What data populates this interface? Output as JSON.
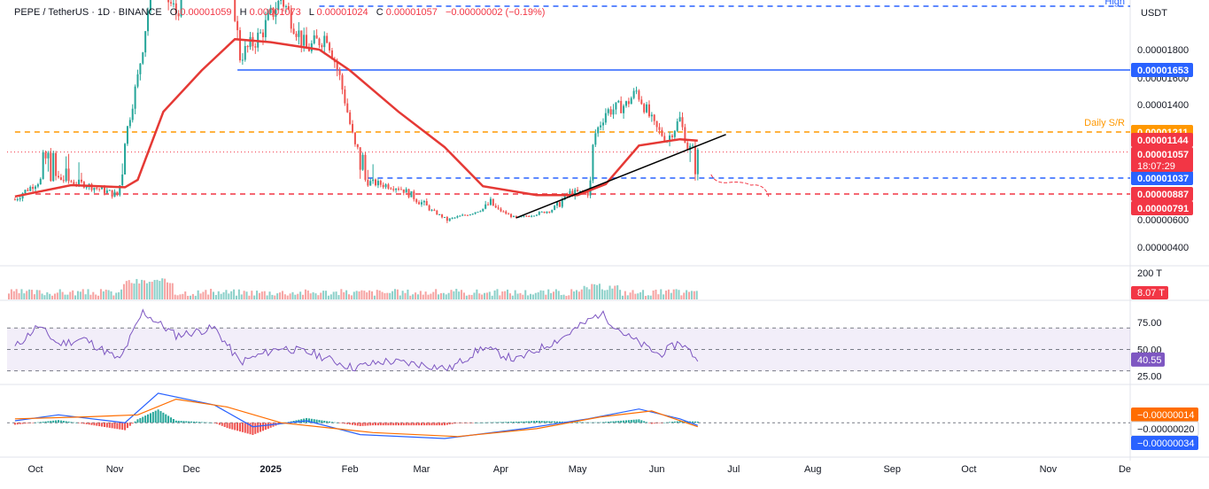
{
  "header": {
    "symbol": "PEPE / TetherUS · 1D · BINANCE",
    "open_label": "O",
    "open": "0.00001059",
    "high_label": "H",
    "high": "0.00001073",
    "low_label": "L",
    "low": "0.00001024",
    "close_label": "C",
    "close": "0.00001057",
    "change": "−0.00000002 (−0.19%)",
    "currency": "USDT"
  },
  "colors": {
    "up": "#26a69a",
    "down": "#ef5350",
    "ma": "#e53935",
    "blue_level": "#2962ff",
    "orange_level": "#ff9800",
    "red_level": "#f23645",
    "trendline": "#000000",
    "rsi_line": "#7e57c2",
    "macd_line": "#2962ff",
    "signal_line": "#ff6d00"
  },
  "chart_data": [
    {
      "type": "candlestick",
      "title": "PEPE / TetherUS · 1D · BINANCE",
      "x_ticks": [
        "Oct",
        "Nov",
        "Dec",
        "2025",
        "Feb",
        "Mar",
        "Apr",
        "May",
        "Jun",
        "Jul",
        "Aug",
        "Sep",
        "Oct",
        "Nov",
        "De"
      ],
      "y_ticks": [
        "0.00001800",
        "0.00001600",
        "0.00001400",
        "0.00000600",
        "0.00000400"
      ],
      "ylim": [
        2.7e-06,
        2.09e-05
      ],
      "price_path": [
        [
          "2024-09-23",
          8.5e-06
        ],
        [
          "2024-10-05",
          1.05e-05
        ],
        [
          "2024-10-20",
          9.8e-06
        ],
        [
          "2024-11-02",
          8.8e-06
        ],
        [
          "2024-11-10",
          1.6e-05
        ],
        [
          "2024-11-16",
          2.3e-05
        ],
        [
          "2024-11-25",
          2.05e-05
        ],
        [
          "2024-12-08",
          2.55e-05
        ],
        [
          "2024-12-16",
          2.35e-05
        ],
        [
          "2024-12-20",
          1.75e-05
        ],
        [
          "2024-12-28",
          1.9e-05
        ],
        [
          "2025-01-05",
          2.15e-05
        ],
        [
          "2025-01-15",
          1.8e-05
        ],
        [
          "2025-01-23",
          1.9e-05
        ],
        [
          "2025-01-28",
          1.6e-05
        ],
        [
          "2025-02-03",
          1.1e-05
        ],
        [
          "2025-02-08",
          1e-05
        ],
        [
          "2025-02-20",
          9.5e-06
        ],
        [
          "2025-03-03",
          8e-06
        ],
        [
          "2025-03-11",
          6e-06
        ],
        [
          "2025-03-20",
          7e-06
        ],
        [
          "2025-03-28",
          8.3e-06
        ],
        [
          "2025-04-07",
          6.2e-06
        ],
        [
          "2025-04-20",
          7.5e-06
        ],
        [
          "2025-04-28",
          9e-06
        ],
        [
          "2025-05-05",
          9e-06
        ],
        [
          "2025-05-08",
          1.2e-05
        ],
        [
          "2025-05-12",
          1.35e-05
        ],
        [
          "2025-05-20",
          1.4e-05
        ],
        [
          "2025-05-24",
          1.5e-05
        ],
        [
          "2025-05-31",
          1.25e-05
        ],
        [
          "2025-06-05",
          1.15e-05
        ],
        [
          "2025-06-10",
          1.3e-05
        ],
        [
          "2025-06-13",
          1.1e-05
        ],
        [
          "2025-06-17",
          1.06e-05
        ]
      ],
      "moving_average": [
        [
          "2024-09-23",
          8.7e-06
        ],
        [
          "2024-10-15",
          9.7e-06
        ],
        [
          "2024-11-05",
          9.5e-06
        ],
        [
          "2024-11-10",
          1.02e-05
        ],
        [
          "2024-11-20",
          1.35e-05
        ],
        [
          "2024-12-05",
          1.65e-05
        ],
        [
          "2024-12-18",
          1.87e-05
        ],
        [
          "2025-01-01",
          1.85e-05
        ],
        [
          "2025-01-20",
          1.8e-05
        ],
        [
          "2025-02-01",
          1.65e-05
        ],
        [
          "2025-02-20",
          1.35e-05
        ],
        [
          "2025-03-10",
          1.1e-05
        ],
        [
          "2025-03-25",
          9.6e-06
        ],
        [
          "2025-04-15",
          8.8e-06
        ],
        [
          "2025-05-01",
          8.8e-06
        ],
        [
          "2025-05-12",
          9.8e-06
        ],
        [
          "2025-05-25",
          1.11e-05
        ],
        [
          "2025-06-10",
          1.15e-05
        ],
        [
          "2025-06-17",
          1.14e-05
        ]
      ],
      "levels": [
        {
          "value": 1.653e-05,
          "label": "0.00001653",
          "color": "#2962ff",
          "style": "solid",
          "from": "2024-12-19"
        },
        {
          "value": 1.211e-05,
          "label": "0.00001211",
          "color": "#ff9800",
          "style": "dashed",
          "from": "2024-09-23",
          "annotation": "Daily S/R"
        },
        {
          "value": 1.037e-05,
          "label": "0.00001037",
          "color": "#2962ff",
          "style": "dashed",
          "from": "2025-02-08"
        },
        {
          "value": 8.87e-06,
          "label": "0.00000887",
          "color": "#f23645",
          "style": "dashed",
          "from": "2024-10-01"
        },
        {
          "value": 2.09e-05,
          "label": "High",
          "color": "#2962ff",
          "style": "dashed",
          "from": "2025-01-20"
        }
      ],
      "price_tags": [
        {
          "value": 1.144e-05,
          "label": "0.00001144",
          "color": "#f23645"
        },
        {
          "value": 1.057e-05,
          "label": "0.00001057",
          "sub": "18:07:29",
          "color": "#f23645"
        },
        {
          "value": 7.91e-06,
          "label": "0.00000791",
          "color": "#f23645"
        }
      ],
      "trendline": [
        [
          "2025-04-07",
          6.3e-06
        ],
        [
          "2025-06-28",
          1.19e-05
        ]
      ],
      "projection_note": "hand-drawn dashed path into early July"
    },
    {
      "type": "bar",
      "name": "Volume",
      "y_tick": "200 T",
      "last_value": "8.07 T"
    },
    {
      "type": "line",
      "name": "RSI",
      "y_ticks": [
        "75.00",
        "50.00",
        "25.00"
      ],
      "ylim": [
        19,
        95
      ],
      "band": [
        30,
        70
      ],
      "last_value": "40.55",
      "points": [
        [
          "2024-09-23",
          52
        ],
        [
          "2024-10-02",
          72
        ],
        [
          "2024-10-10",
          55
        ],
        [
          "2024-10-20",
          60
        ],
        [
          "2024-11-03",
          40
        ],
        [
          "2024-11-12",
          85
        ],
        [
          "2024-11-25",
          63
        ],
        [
          "2024-12-10",
          70
        ],
        [
          "2024-12-20",
          38
        ],
        [
          "2025-01-05",
          52
        ],
        [
          "2025-01-18",
          46
        ],
        [
          "2025-02-02",
          33
        ],
        [
          "2025-02-15",
          39
        ],
        [
          "2025-03-01",
          36
        ],
        [
          "2025-03-12",
          32
        ],
        [
          "2025-03-25",
          52
        ],
        [
          "2025-04-07",
          40
        ],
        [
          "2025-04-25",
          61
        ],
        [
          "2025-05-10",
          84
        ],
        [
          "2025-05-20",
          63
        ],
        [
          "2025-06-02",
          45
        ],
        [
          "2025-06-10",
          57
        ],
        [
          "2025-06-17",
          41
        ]
      ]
    },
    {
      "type": "line",
      "name": "MACD",
      "last_values": [
        "−0.00000014",
        "−0.00000020",
        "−0.00000034"
      ],
      "ylim": [
        -1.7e-06,
        1.9e-06
      ],
      "macd": [
        [
          "2024-09-23",
          1e-07
        ],
        [
          "2024-10-10",
          4e-07
        ],
        [
          "2024-11-05",
          0.0
        ],
        [
          "2024-11-18",
          1.5e-06
        ],
        [
          "2024-12-10",
          9e-07
        ],
        [
          "2024-12-25",
          -2e-07
        ],
        [
          "2025-01-15",
          1e-07
        ],
        [
          "2025-02-05",
          -6e-07
        ],
        [
          "2025-03-10",
          -8e-07
        ],
        [
          "2025-04-10",
          -3e-07
        ],
        [
          "2025-05-05",
          2e-07
        ],
        [
          "2025-05-25",
          7e-07
        ],
        [
          "2025-06-10",
          2e-07
        ],
        [
          "2025-06-17",
          -1.4e-07
        ]
      ],
      "signal": [
        [
          "2024-09-23",
          2e-07
        ],
        [
          "2024-10-20",
          3e-07
        ],
        [
          "2024-11-10",
          4e-07
        ],
        [
          "2024-11-25",
          1.2e-06
        ],
        [
          "2024-12-15",
          8e-07
        ],
        [
          "2025-01-05",
          0.0
        ],
        [
          "2025-02-10",
          -5e-07
        ],
        [
          "2025-03-15",
          -7e-07
        ],
        [
          "2025-04-15",
          -3e-07
        ],
        [
          "2025-05-10",
          3e-07
        ],
        [
          "2025-05-30",
          6e-07
        ],
        [
          "2025-06-17",
          -2e-07
        ]
      ],
      "histogram_last": -3.4e-07
    }
  ]
}
